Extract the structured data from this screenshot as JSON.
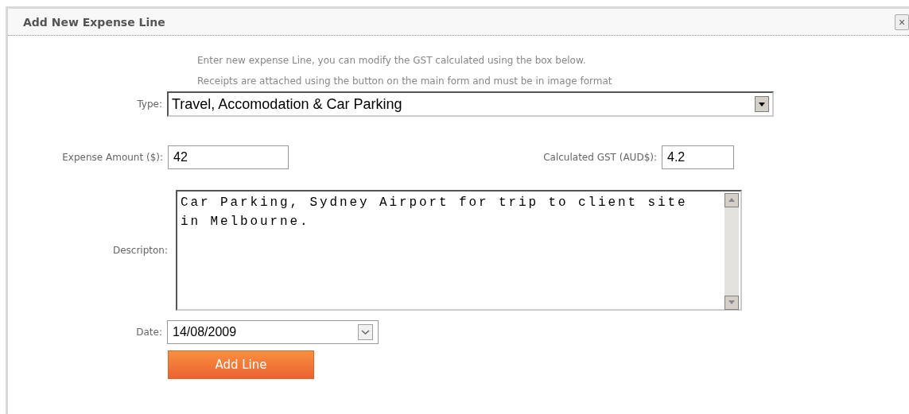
{
  "dialog": {
    "title": "Add New Expense Line",
    "close": "×"
  },
  "intro": [
    "Enter new expense Line, you can modify the GST calculated using the box below.",
    "Receipts are attached using the button on the main form and must be in image format"
  ],
  "type": {
    "label": "Type:",
    "value": "Travel, Accomodation & Car Parking"
  },
  "amount": {
    "label": "Expense Amount ($):",
    "value": "42"
  },
  "gst": {
    "label": "Calculated GST (AUD$):",
    "value": "4.2"
  },
  "description": {
    "label": "Descripton:",
    "value": "Car Parking, Sydney Airport for trip to client site in Melbourne."
  },
  "date": {
    "label": "Date:",
    "value": "14/08/2009"
  },
  "button": "Add Line"
}
